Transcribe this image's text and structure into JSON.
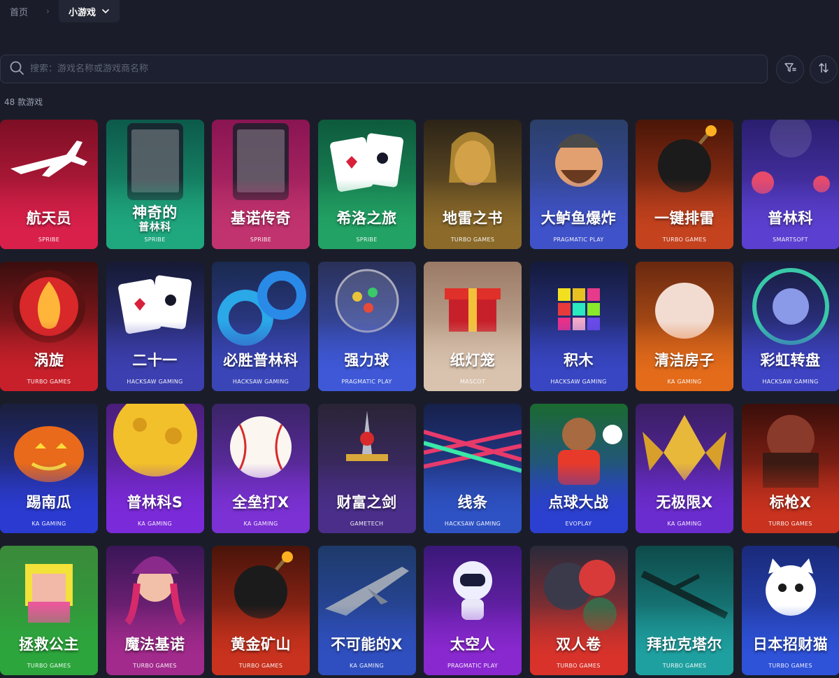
{
  "breadcrumb": {
    "home": "首页",
    "separator": "›",
    "current": "小游戏"
  },
  "search": {
    "placeholder": "搜索：游戏名称或游戏商名称"
  },
  "count_label": "48 款游戏",
  "games": [
    {
      "title": "航天员",
      "provider": "SPRIBE",
      "colors": [
        "#7d0f24",
        "#d8204a"
      ],
      "icon": "airplane-icon"
    },
    {
      "title": "神奇的",
      "subtitle": "普林科",
      "provider": "SPRIBE",
      "colors": [
        "#0c5a4a",
        "#1fa77e"
      ],
      "icon": "phone-screen-icon"
    },
    {
      "title": "基诺传奇",
      "provider": "SPRIBE",
      "colors": [
        "#8a1452",
        "#c1336e"
      ],
      "icon": "phone-screen-icon"
    },
    {
      "title": "希洛之旅",
      "provider": "SPRIBE",
      "colors": [
        "#0d5a3d",
        "#22a264"
      ],
      "icon": "playing-cards-icon"
    },
    {
      "title": "地雷之书",
      "provider": "TURBO GAMES",
      "colors": [
        "#2c2418",
        "#8b6a2a"
      ],
      "icon": "pharaoh-icon"
    },
    {
      "title": "大鲈鱼爆炸",
      "provider": "PRAGMATIC PLAY",
      "colors": [
        "#2b3f69",
        "#3f52c9"
      ],
      "icon": "fisherman-icon"
    },
    {
      "title": "一键排雷",
      "provider": "TURBO GAMES",
      "colors": [
        "#4a1608",
        "#c4421e"
      ],
      "icon": "bomb-icon"
    },
    {
      "title": "普林科",
      "provider": "SMARTSOFT",
      "colors": [
        "#2a1e6e",
        "#5b3fd0"
      ],
      "icon": "plinko-icon"
    },
    {
      "title": "涡旋",
      "provider": "TURBO GAMES",
      "colors": [
        "#3a0e0e",
        "#c8202a"
      ],
      "icon": "flame-icon"
    },
    {
      "title": "二十一",
      "provider": "HACKSAW GAMING",
      "colors": [
        "#161a33",
        "#3c3fb0"
      ],
      "icon": "playing-cards-icon"
    },
    {
      "title": "必胜普林科",
      "provider": "HACKSAW GAMING",
      "colors": [
        "#1a2a4f",
        "#3a46b8"
      ],
      "icon": "rings-icon"
    },
    {
      "title": "强力球",
      "provider": "PRAGMATIC PLAY",
      "colors": [
        "#2a3158",
        "#3e58d8"
      ],
      "icon": "lottery-ball-icon"
    },
    {
      "title": "纸灯笼",
      "provider": "MASCOT",
      "colors": [
        "#9a7a66",
        "#d9c3ae"
      ],
      "icon": "gift-box-icon"
    },
    {
      "title": "积木",
      "provider": "HACKSAW GAMING",
      "colors": [
        "#141a3a",
        "#3846c4"
      ],
      "icon": "color-blocks-icon"
    },
    {
      "title": "清洁房子",
      "provider": "KA GAMING",
      "colors": [
        "#6a2810",
        "#e36b1a"
      ],
      "icon": "fist-icon"
    },
    {
      "title": "彩虹转盘",
      "provider": "HACKSAW GAMING",
      "colors": [
        "#181c3c",
        "#3d43c2"
      ],
      "icon": "wheel-icon"
    },
    {
      "title": "踢南瓜",
      "provider": "KA GAMING",
      "colors": [
        "#1a1f3c",
        "#2b3bd2"
      ],
      "icon": "pumpkin-icon"
    },
    {
      "title": "普林科S",
      "provider": "KA GAMING",
      "colors": [
        "#4a1e7a",
        "#7a2ad8"
      ],
      "icon": "cheese-planet-icon"
    },
    {
      "title": "全垒打X",
      "provider": "KA GAMING",
      "colors": [
        "#3a2466",
        "#7b31d4"
      ],
      "icon": "baseball-icon"
    },
    {
      "title": "财富之剑",
      "provider": "GAMETECH",
      "colors": [
        "#2a2436",
        "#4a2e8a"
      ],
      "icon": "sword-icon"
    },
    {
      "title": "线条",
      "provider": "HACKSAW GAMING",
      "colors": [
        "#16204a",
        "#2e52c4"
      ],
      "icon": "lines-icon"
    },
    {
      "title": "点球大战",
      "provider": "EVOPLAY",
      "colors": [
        "#1b6a30",
        "#2b3fd0"
      ],
      "icon": "footballer-icon"
    },
    {
      "title": "无极限X",
      "provider": "KA GAMING",
      "colors": [
        "#3a1e62",
        "#6b2ccf"
      ],
      "icon": "spaceship-icon"
    },
    {
      "title": "标枪X",
      "provider": "TURBO GAMES",
      "colors": [
        "#3a0e0a",
        "#c8321e"
      ],
      "icon": "soldier-icon"
    },
    {
      "title": "拯救公主",
      "provider": "TURBO GAMES",
      "colors": [
        "#3a8a3a",
        "#2ca63c"
      ],
      "icon": "pixel-princess-icon"
    },
    {
      "title": "魔法基诺",
      "provider": "TURBO GAMES",
      "colors": [
        "#3a1658",
        "#a22a8c"
      ],
      "icon": "witch-icon"
    },
    {
      "title": "黄金矿山",
      "provider": "TURBO GAMES",
      "colors": [
        "#4a140a",
        "#c8321e"
      ],
      "icon": "bomb-icon"
    },
    {
      "title": "不可能的X",
      "provider": "KA GAMING",
      "colors": [
        "#1e3a6a",
        "#2f4fc0"
      ],
      "icon": "jet-icon"
    },
    {
      "title": "太空人",
      "provider": "PRAGMATIC PLAY",
      "colors": [
        "#3a1878",
        "#8a28d0"
      ],
      "icon": "astronaut-icon"
    },
    {
      "title": "双人卷",
      "provider": "TURBO GAMES",
      "colors": [
        "#2a2a3a",
        "#d8322a"
      ],
      "icon": "hand-gesture-icon"
    },
    {
      "title": "拜拉克塔尔",
      "provider": "TURBO GAMES",
      "colors": [
        "#0e4a4a",
        "#1fa0a0"
      ],
      "icon": "drone-icon"
    },
    {
      "title": "日本招财猫",
      "provider": "TURBO GAMES",
      "colors": [
        "#1a2a7a",
        "#2e52d8"
      ],
      "icon": "lucky-cat-icon"
    }
  ]
}
